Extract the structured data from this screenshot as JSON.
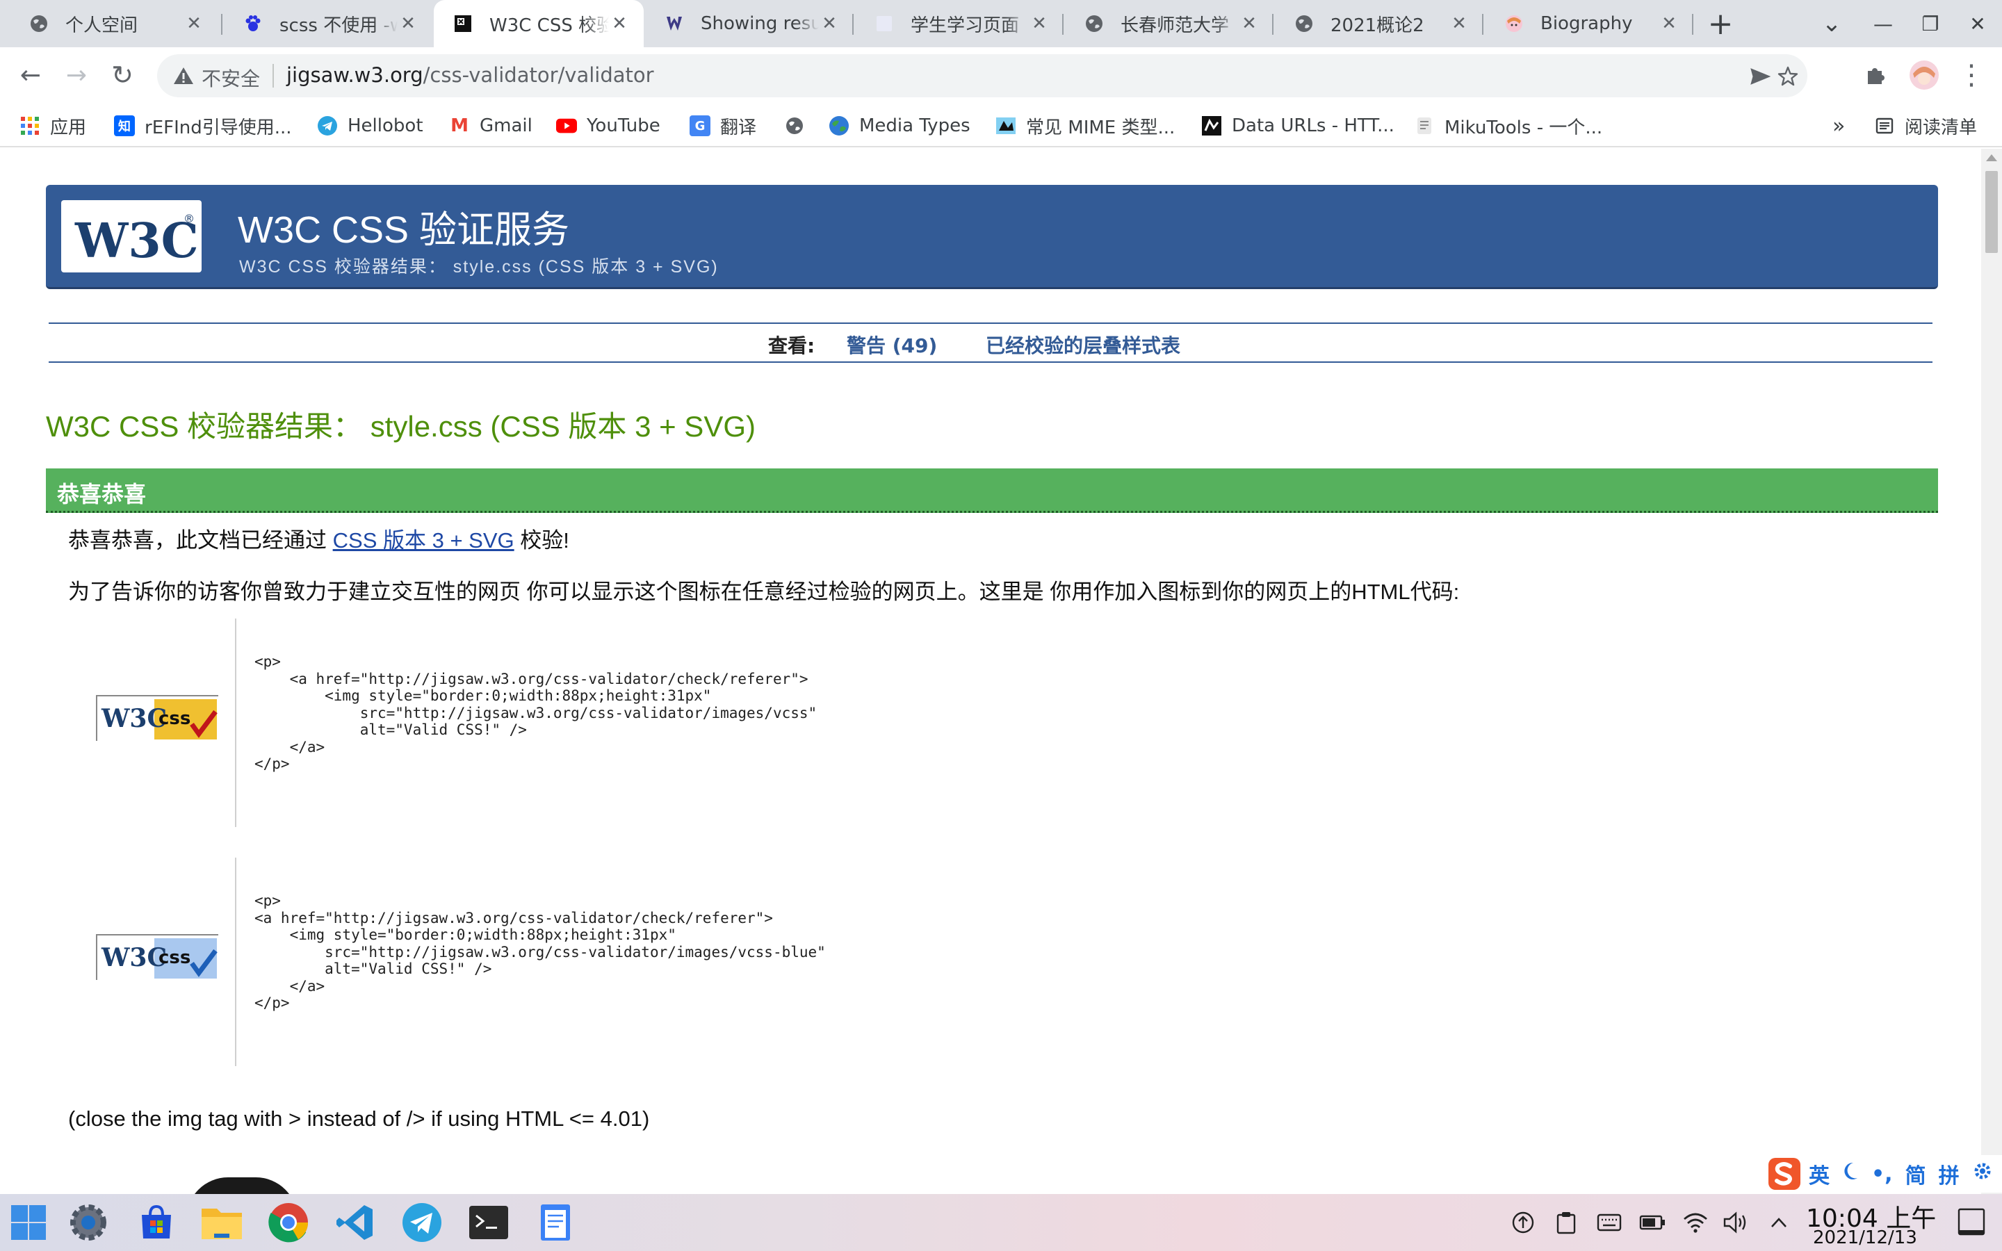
{
  "tabs": [
    {
      "title": "个人空间",
      "icon": "globe-icon"
    },
    {
      "title": "scss 不使用 -w",
      "icon": "paw-icon"
    },
    {
      "title": "W3C CSS 校验",
      "icon": "w3c-icon"
    },
    {
      "title": "Showing resu",
      "icon": "hu-icon"
    },
    {
      "title": "学生学习页面",
      "icon": "page-icon"
    },
    {
      "title": "长春师范大学",
      "icon": "globe-icon"
    },
    {
      "title": "2021概论2",
      "icon": "globe-icon"
    },
    {
      "title": "Biography",
      "icon": "avatar-icon"
    }
  ],
  "tab_close_glyph": "✕",
  "new_tab_glyph": "+",
  "window": {
    "tabsearch_glyph": "⌄",
    "minimize_glyph": "—",
    "restore_glyph": "❐",
    "close_glyph": "✕"
  },
  "toolbar": {
    "back_glyph": "←",
    "forward_glyph": "→",
    "reload_glyph": "↻",
    "insecure_label": "不安全",
    "url_host": "jigsaw.w3.org",
    "url_path": "/css-validator/validator",
    "menu_glyph": "⋮"
  },
  "bookmarks": [
    {
      "label": "应用",
      "icon": "apps-grid-icon"
    },
    {
      "label": "rEFInd引导使用...",
      "icon": "zhihu-icon",
      "icon_text": "知"
    },
    {
      "label": "Hellobot",
      "icon": "telegram-icon"
    },
    {
      "label": "Gmail",
      "icon": "gmail-icon",
      "icon_text": "M"
    },
    {
      "label": "YouTube",
      "icon": "youtube-icon"
    },
    {
      "label": "翻译",
      "icon": "translate-icon",
      "icon_text": "G"
    },
    {
      "label": "",
      "icon": "globe-icon"
    },
    {
      "label": "Media Types",
      "icon": "earth-icon"
    },
    {
      "label": "常见 MIME 类型...",
      "icon": "mdn-icon"
    },
    {
      "label": "Data URLs - HTT...",
      "icon": "mdn-black-icon"
    },
    {
      "label": "MikuTools - 一个...",
      "icon": "miku-icon"
    }
  ],
  "bookmarks_more": "»",
  "reading_list": "阅读清单",
  "banner": {
    "logo_text": "W3C",
    "logo_reg": "®",
    "title": "W3C CSS 验证服务",
    "subtitle": "W3C CSS 校验器结果： style.css (CSS 版本 3 + SVG)"
  },
  "viewbar": {
    "label": "查看:",
    "warnings_link": "警告 (49)",
    "validated_link": "已经校验的层叠样式表"
  },
  "result_title": "W3C CSS 校验器结果： style.css (CSS 版本 3 + SVG)",
  "congrats": {
    "heading": "恭喜恭喜",
    "line_before": "恭喜恭喜，此文档已经通过 ",
    "line_link": "CSS 版本 3 + SVG",
    "line_after": " 校验!",
    "explain": "为了告诉你的访客你曾致力于建立交互性的网页 你可以显示这个图标在任意经过检验的网页上。这里是 你用作加入图标到你的网页上的HTML代码:"
  },
  "badges": [
    {
      "w3c": "W3C",
      "css": "css",
      "accent": "#f0c030",
      "check_color": "#c0151b",
      "code": "<p>\n    <a href=\"http://jigsaw.w3.org/css-validator/check/referer\">\n        <img style=\"border:0;width:88px;height:31px\"\n            src=\"http://jigsaw.w3.org/css-validator/images/vcss\"\n            alt=\"Valid CSS!\" />\n    </a>\n</p>"
    },
    {
      "w3c": "W3C",
      "css": "css",
      "accent": "#a9c8ef",
      "check_color": "#1d5fb8",
      "code": "<p>\n<a href=\"http://jigsaw.w3.org/css-validator/check/referer\">\n    <img style=\"border:0;width:88px;height:31px\"\n        src=\"http://jigsaw.w3.org/css-validator/images/vcss-blue\"\n        alt=\"Valid CSS!\" />\n    </a>\n</p>"
    }
  ],
  "close_note": "(close the img tag with > instead of /> if using HTML <= 4.01)",
  "ime": {
    "lang": "英",
    "punct": "•,",
    "simplified": "简",
    "pinyin": "拼"
  },
  "clock": {
    "time": "10:04 上午",
    "date": "2021/12/13"
  },
  "colors": {
    "w3c_blue": "#335b96",
    "success_green": "#56b15d",
    "title_green": "#4e8f0b",
    "link_blue": "#1e48a5"
  }
}
